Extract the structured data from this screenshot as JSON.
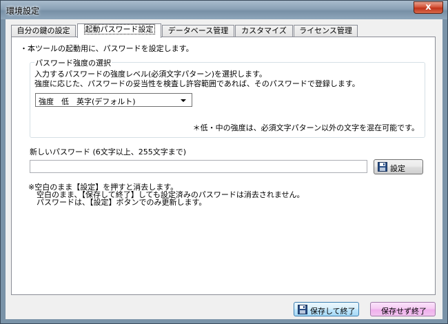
{
  "window": {
    "title": "環境設定",
    "close_label": "x"
  },
  "tabs": [
    {
      "label": "自分の鍵の設定",
      "active": false
    },
    {
      "label": "起動パスワード設定",
      "active": true
    },
    {
      "label": "データベース管理",
      "active": false
    },
    {
      "label": "カスタマイズ",
      "active": false
    },
    {
      "label": "ライセンス管理",
      "active": false
    }
  ],
  "panel": {
    "intro": "・本ツールの起動用に、パスワードを設定します。",
    "strength_group": {
      "legend": "パスワード強度の選択",
      "desc_line1": "入力するパスワードの強度レベル(必須文字パターン)を選択します。",
      "desc_line2": "強度に応じた、パスワードの妥当性を検査し許容範囲であれば、そのパスワードで登録します。",
      "selected_strength": "強度　低　英字(デフォルト)",
      "note": "＊低・中の強度は、必須文字パターン以外の文字を混在可能です。"
    },
    "new_password": {
      "label": "新しいパスワード (6文字以上、255文字まで)",
      "value": "",
      "set_button": "設定"
    },
    "notes": [
      "※空白のまま【設定】を押すと消去します。",
      "空白のまま、【保存して終了】しても設定済みのパスワードは消去されません。",
      "パスワードは、【設定】ボタンでのみ更新します。"
    ]
  },
  "footer": {
    "save_close": "保存して終了",
    "discard_close": "保存せず終了"
  },
  "colors": {
    "titlebar": "#8aa1b6",
    "close_button": "#c0341a",
    "save_button": "#bee6fd",
    "discard_button": "#efb0ec"
  }
}
